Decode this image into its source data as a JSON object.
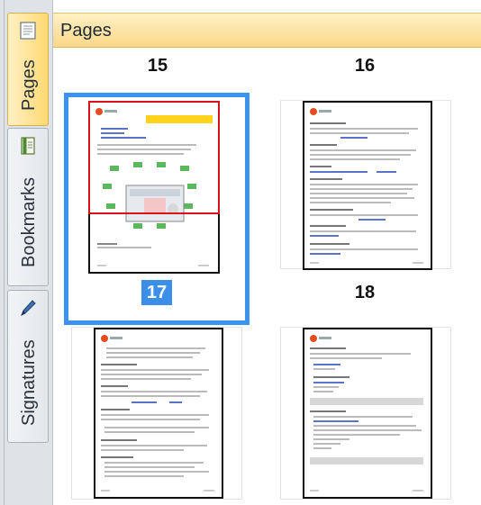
{
  "sidebar": {
    "tabs": [
      {
        "label": "Pages",
        "icon": "pages-icon",
        "active": true
      },
      {
        "label": "Bookmarks",
        "icon": "bookmark-icon",
        "active": false
      },
      {
        "label": "Signatures",
        "icon": "pen-icon",
        "active": false
      }
    ]
  },
  "panel": {
    "title": "Pages"
  },
  "thumbnails": [
    {
      "page": "15",
      "selected": false
    },
    {
      "page": "16",
      "selected": false
    },
    {
      "page": "17",
      "selected": true
    },
    {
      "page": "18",
      "selected": false
    }
  ],
  "colors": {
    "accent": "#3b93ee",
    "active_tab": "#ffd872",
    "header": "#fbd889",
    "view_box": "#d7141a"
  }
}
